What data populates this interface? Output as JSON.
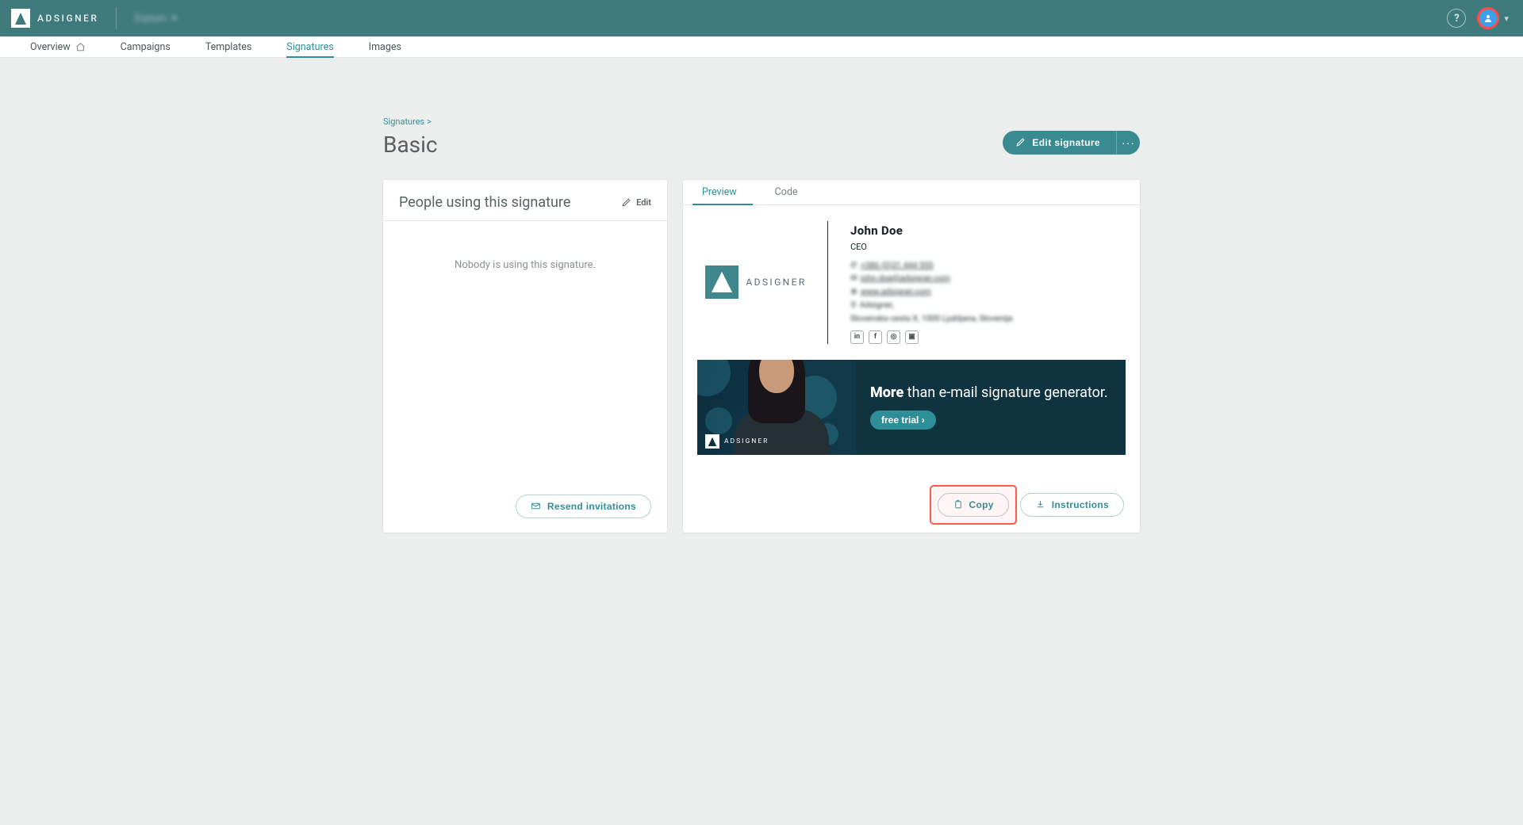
{
  "brand": "ADSIGNER",
  "workspace": "Erpium",
  "nav": {
    "overview": "Overview",
    "campaigns": "Campaigns",
    "templates": "Templates",
    "signatures": "Signatures",
    "images": "Images",
    "active": "signatures"
  },
  "breadcrumb": "Signatures >",
  "page_title": "Basic",
  "actions": {
    "edit_signature": "Edit signature",
    "more": "···"
  },
  "people_card": {
    "title": "People using this signature",
    "edit": "Edit",
    "empty": "Nobody is using this signature.",
    "resend": "Resend invitations"
  },
  "preview_card": {
    "tabs": {
      "preview": "Preview",
      "code": "Code",
      "active": "preview"
    },
    "copy": "Copy",
    "instructions": "Instructions"
  },
  "signature": {
    "name": "John Doe",
    "role": "CEO",
    "logo_text": "ADSIGNER",
    "phone": "+386 (0)31 444 555",
    "email": "john.doe@adsigner.com",
    "website": "www.adsigner.com",
    "company": "Adsigner,",
    "address": "Slovenska cesta X, 1000 Ljubljana, Slovenija",
    "social": [
      "in",
      "f",
      "◎",
      "▣"
    ]
  },
  "banner": {
    "headline_strong": "More",
    "headline_rest": " than e-mail signature generator.",
    "cta": "free trial ›",
    "mini_brand": "ADSIGNER"
  }
}
